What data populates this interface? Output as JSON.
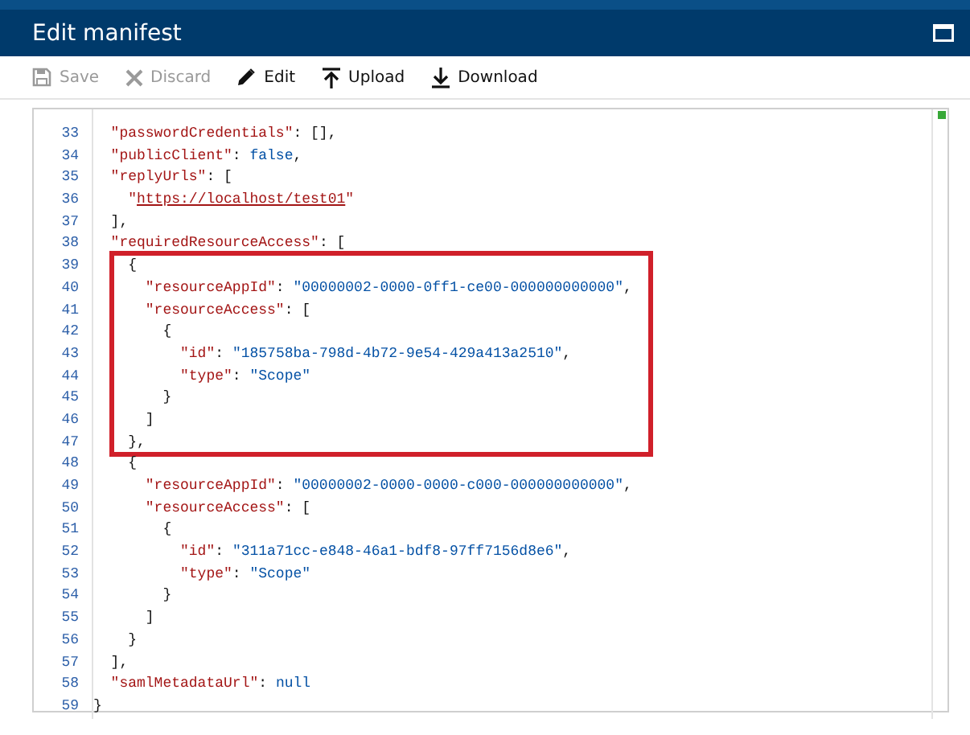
{
  "window": {
    "title": "Edit manifest"
  },
  "toolbar": [
    {
      "kind": "save",
      "label": "Save",
      "disabled": true
    },
    {
      "kind": "discard",
      "label": "Discard",
      "disabled": true
    },
    {
      "kind": "edit",
      "label": "Edit",
      "disabled": false
    },
    {
      "kind": "upload",
      "label": "Upload",
      "disabled": false
    },
    {
      "kind": "download",
      "label": "Download",
      "disabled": false
    }
  ],
  "editor": {
    "segments": [
      {
        "kind": "plain",
        "lines": [
          {
            "number": "33",
            "tokens": [
              {
                "kind": "key",
                "text": "  \"passwordCredentials\""
              },
              {
                "kind": "punct",
                "text": ": [],"
              }
            ]
          },
          {
            "number": "34",
            "tokens": [
              {
                "kind": "key",
                "text": "  \"publicClient\""
              },
              {
                "kind": "punct",
                "text": ": "
              },
              {
                "kind": "keyword",
                "text": "false"
              },
              {
                "kind": "punct",
                "text": ","
              }
            ]
          },
          {
            "number": "35",
            "tokens": [
              {
                "kind": "key",
                "text": "  \"replyUrls\""
              },
              {
                "kind": "punct",
                "text": ": ["
              }
            ]
          },
          {
            "number": "36",
            "tokens": [
              {
                "kind": "key",
                "text": "    \""
              },
              {
                "kind": "url",
                "text": "https://localhost/test01"
              },
              {
                "kind": "key",
                "text": "\""
              }
            ]
          },
          {
            "number": "37",
            "tokens": [
              {
                "kind": "punct",
                "text": "  ],"
              }
            ]
          },
          {
            "number": "38",
            "tokens": [
              {
                "kind": "key",
                "text": "  \"requiredResourceAccess\""
              },
              {
                "kind": "punct",
                "text": ": ["
              }
            ]
          }
        ]
      },
      {
        "kind": "boxed",
        "lines": [
          {
            "number": "39",
            "tokens": [
              {
                "kind": "punct",
                "text": "    {"
              }
            ]
          },
          {
            "number": "40",
            "tokens": [
              {
                "kind": "key",
                "text": "      \"resourceAppId\""
              },
              {
                "kind": "punct",
                "text": ": "
              },
              {
                "kind": "string",
                "text": "\"00000002-0000-0ff1-ce00-000000000000\""
              },
              {
                "kind": "punct",
                "text": ","
              }
            ]
          },
          {
            "number": "41",
            "tokens": [
              {
                "kind": "key",
                "text": "      \"resourceAccess\""
              },
              {
                "kind": "punct",
                "text": ": ["
              }
            ]
          },
          {
            "number": "42",
            "tokens": [
              {
                "kind": "punct",
                "text": "        {"
              }
            ]
          },
          {
            "number": "43",
            "tokens": [
              {
                "kind": "key",
                "text": "          \"id\""
              },
              {
                "kind": "punct",
                "text": ": "
              },
              {
                "kind": "string",
                "text": "\"185758ba-798d-4b72-9e54-429a413a2510\""
              },
              {
                "kind": "punct",
                "text": ","
              }
            ]
          },
          {
            "number": "44",
            "tokens": [
              {
                "kind": "key",
                "text": "          \"type\""
              },
              {
                "kind": "punct",
                "text": ": "
              },
              {
                "kind": "string",
                "text": "\"Scope\""
              }
            ]
          },
          {
            "number": "45",
            "tokens": [
              {
                "kind": "punct",
                "text": "        }"
              }
            ]
          },
          {
            "number": "46",
            "tokens": [
              {
                "kind": "punct",
                "text": "      ]"
              }
            ]
          },
          {
            "number": "47",
            "tokens": [
              {
                "kind": "punct",
                "text": "    },"
              }
            ]
          }
        ]
      },
      {
        "kind": "plain",
        "lines": [
          {
            "number": "48",
            "tokens": [
              {
                "kind": "punct",
                "text": "    {"
              }
            ]
          },
          {
            "number": "49",
            "tokens": [
              {
                "kind": "key",
                "text": "      \"resourceAppId\""
              },
              {
                "kind": "punct",
                "text": ": "
              },
              {
                "kind": "string",
                "text": "\"00000002-0000-0000-c000-000000000000\""
              },
              {
                "kind": "punct",
                "text": ","
              }
            ]
          },
          {
            "number": "50",
            "tokens": [
              {
                "kind": "key",
                "text": "      \"resourceAccess\""
              },
              {
                "kind": "punct",
                "text": ": ["
              }
            ]
          },
          {
            "number": "51",
            "tokens": [
              {
                "kind": "punct",
                "text": "        {"
              }
            ]
          },
          {
            "number": "52",
            "tokens": [
              {
                "kind": "key",
                "text": "          \"id\""
              },
              {
                "kind": "punct",
                "text": ": "
              },
              {
                "kind": "string",
                "text": "\"311a71cc-e848-46a1-bdf8-97ff7156d8e6\""
              },
              {
                "kind": "punct",
                "text": ","
              }
            ]
          },
          {
            "number": "53",
            "tokens": [
              {
                "kind": "key",
                "text": "          \"type\""
              },
              {
                "kind": "punct",
                "text": ": "
              },
              {
                "kind": "string",
                "text": "\"Scope\""
              }
            ]
          },
          {
            "number": "54",
            "tokens": [
              {
                "kind": "punct",
                "text": "        }"
              }
            ]
          },
          {
            "number": "55",
            "tokens": [
              {
                "kind": "punct",
                "text": "      ]"
              }
            ]
          },
          {
            "number": "56",
            "tokens": [
              {
                "kind": "punct",
                "text": "    }"
              }
            ]
          },
          {
            "number": "57",
            "tokens": [
              {
                "kind": "punct",
                "text": "  ],"
              }
            ]
          },
          {
            "number": "58",
            "tokens": [
              {
                "kind": "key",
                "text": "  \"samlMetadataUrl\""
              },
              {
                "kind": "punct",
                "text": ": "
              },
              {
                "kind": "keyword",
                "text": "null"
              }
            ]
          },
          {
            "number": "59",
            "tokens": [
              {
                "kind": "punct",
                "text": "}"
              }
            ]
          }
        ]
      }
    ]
  }
}
